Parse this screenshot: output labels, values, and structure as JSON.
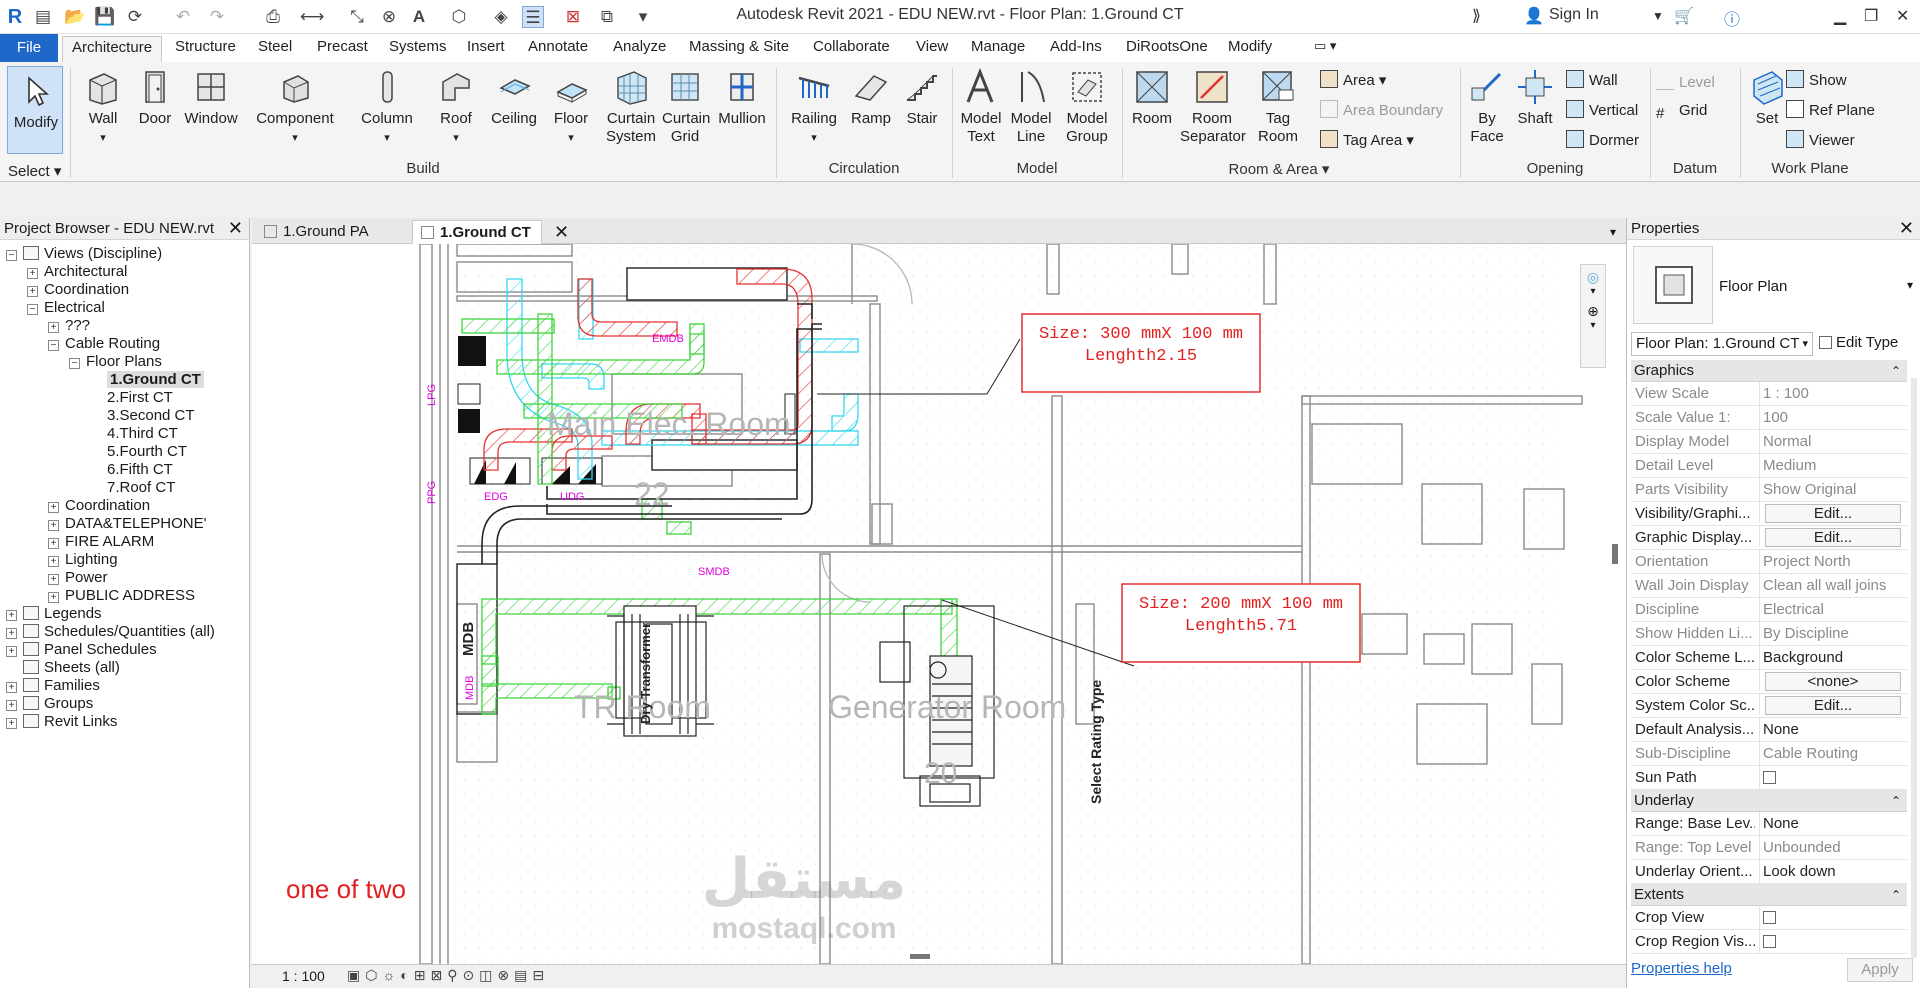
{
  "app": {
    "title": "Autodesk Revit 2021 - EDU NEW.rvt - Floor Plan: 1.Ground CT",
    "sign_in": "Sign In"
  },
  "ribbon_tabs": [
    "File",
    "Architecture",
    "Structure",
    "Steel",
    "Precast",
    "Systems",
    "Insert",
    "Annotate",
    "Analyze",
    "Massing & Site",
    "Collaborate",
    "View",
    "Manage",
    "Add-Ins",
    "DiRootsOne",
    "Modify"
  ],
  "ribbon": {
    "select_label": "Select",
    "modify": "Modify",
    "build": {
      "label": "Build",
      "wall": "Wall",
      "door": "Door",
      "window": "Window",
      "component": "Component",
      "column": "Column",
      "roof": "Roof",
      "ceiling": "Ceiling",
      "floor": "Floor",
      "curtain_system": [
        "Curtain",
        "System"
      ],
      "curtain_grid": [
        "Curtain",
        "Grid"
      ],
      "mullion": "Mullion"
    },
    "circulation": {
      "label": "Circulation",
      "railing": "Railing",
      "ramp": "Ramp",
      "stair": "Stair"
    },
    "model": {
      "label": "Model",
      "model_text": [
        "Model",
        "Text"
      ],
      "model_line": [
        "Model",
        "Line"
      ],
      "model_group": [
        "Model",
        "Group"
      ]
    },
    "room_area": {
      "label": "Room & Area",
      "room": "Room",
      "room_separator": [
        "Room",
        "Separator"
      ],
      "tag_room": [
        "Tag",
        "Room"
      ],
      "area": "Area",
      "area_boundary": "Area  Boundary",
      "tag_area": "Tag  Area"
    },
    "opening": {
      "label": "Opening",
      "by_face": [
        "By",
        "Face"
      ],
      "shaft": "Shaft",
      "wall": "Wall",
      "vertical": "Vertical",
      "dormer": "Dormer"
    },
    "datum": {
      "label": "Datum",
      "level": "Level",
      "grid": "Grid"
    },
    "work_plane": {
      "label": "Work Plane",
      "set": "Set",
      "show": "Show",
      "ref_plane": "Ref  Plane",
      "viewer": "Viewer"
    }
  },
  "project_browser": {
    "title": "Project Browser - EDU NEW.rvt",
    "items": [
      {
        "label": "Views (Discipline)",
        "indent": 0,
        "pm": "−",
        "icon": true
      },
      {
        "label": "Architectural",
        "indent": 1,
        "pm": "+"
      },
      {
        "label": "Coordination",
        "indent": 1,
        "pm": "+"
      },
      {
        "label": "Electrical",
        "indent": 1,
        "pm": "−"
      },
      {
        "label": "???",
        "indent": 2,
        "pm": "+"
      },
      {
        "label": "Cable Routing",
        "indent": 2,
        "pm": "−"
      },
      {
        "label": "Floor Plans",
        "indent": 3,
        "pm": "−"
      },
      {
        "label": "1.Ground CT",
        "indent": 4,
        "pm": "",
        "selected": true
      },
      {
        "label": "2.First CT",
        "indent": 4,
        "pm": ""
      },
      {
        "label": "3.Second CT",
        "indent": 4,
        "pm": ""
      },
      {
        "label": "4.Third CT",
        "indent": 4,
        "pm": ""
      },
      {
        "label": "5.Fourth CT",
        "indent": 4,
        "pm": ""
      },
      {
        "label": "6.Fifth CT",
        "indent": 4,
        "pm": ""
      },
      {
        "label": "7.Roof CT",
        "indent": 4,
        "pm": ""
      },
      {
        "label": "Coordination",
        "indent": 2,
        "pm": "+"
      },
      {
        "label": "DATA&TELEPHONE'",
        "indent": 2,
        "pm": "+"
      },
      {
        "label": "FIRE ALARM",
        "indent": 2,
        "pm": "+"
      },
      {
        "label": "Lighting",
        "indent": 2,
        "pm": "+"
      },
      {
        "label": "Power",
        "indent": 2,
        "pm": "+"
      },
      {
        "label": "PUBLIC ADDRESS",
        "indent": 2,
        "pm": "+"
      },
      {
        "label": "Legends",
        "indent": 0,
        "pm": "+",
        "icon": true
      },
      {
        "label": "Schedules/Quantities (all)",
        "indent": 0,
        "pm": "+",
        "icon": true
      },
      {
        "label": "Panel Schedules",
        "indent": 0,
        "pm": "+",
        "icon": true
      },
      {
        "label": "Sheets (all)",
        "indent": 0,
        "pm": "",
        "icon": true
      },
      {
        "label": "Families",
        "indent": 0,
        "pm": "+",
        "icon": true
      },
      {
        "label": "Groups",
        "indent": 0,
        "pm": "+",
        "icon": true
      },
      {
        "label": "Revit Links",
        "indent": 0,
        "pm": "+",
        "icon": true
      }
    ]
  },
  "view_tabs": [
    {
      "label": "1.Ground PA",
      "active": false
    },
    {
      "label": "1.Ground CT",
      "active": true
    }
  ],
  "drawing": {
    "rooms": [
      "Main Elec. Room",
      "22",
      "TR Room",
      "Generator Room",
      "20"
    ],
    "tags": [
      "EMDB",
      "SMDB",
      "LPG",
      "PPG",
      "EDG",
      "UDG",
      "MDB",
      "MDB"
    ],
    "callout1": [
      "Size:  300  mmX  100  mm",
      "Lenghth2.15"
    ],
    "callout2": [
      "Size:  200  mmX  100  mm",
      "Lenghth5.71"
    ],
    "transformer": "Dry Transformer",
    "select_rating": "Select Rating Type",
    "note": "one of two",
    "watermark_lettering": "مستقل",
    "watermark": "mostaql.com"
  },
  "status": {
    "scale": "1 : 100"
  },
  "properties": {
    "title": "Properties",
    "type": "Floor Plan",
    "selector": "Floor Plan: 1.Ground CT",
    "edit_type": "Edit Type",
    "sections": [
      {
        "name": "Graphics",
        "rows": [
          {
            "k": "View Scale",
            "v": "1 : 100",
            "dis": true
          },
          {
            "k": "Scale Value    1:",
            "v": "100",
            "dis": true
          },
          {
            "k": "Display Model",
            "v": "Normal",
            "dis": true
          },
          {
            "k": "Detail Level",
            "v": "Medium",
            "dis": true
          },
          {
            "k": "Parts Visibility",
            "v": "Show Original",
            "dis": true
          },
          {
            "k": "Visibility/Graphi...",
            "v": "Edit...",
            "btn": true
          },
          {
            "k": "Graphic Display...",
            "v": "Edit...",
            "btn": true
          },
          {
            "k": "Orientation",
            "v": "Project North",
            "dis": true
          },
          {
            "k": "Wall Join Display",
            "v": "Clean all wall joins",
            "dis": true
          },
          {
            "k": "Discipline",
            "v": "Electrical",
            "dis": true
          },
          {
            "k": "Show Hidden Li...",
            "v": "By Discipline",
            "dis": true
          },
          {
            "k": "Color Scheme L...",
            "v": "Background"
          },
          {
            "k": "Color Scheme",
            "v": "<none>",
            "btn": true
          },
          {
            "k": "System Color Sc...",
            "v": "Edit...",
            "btn": true
          },
          {
            "k": "Default Analysis...",
            "v": "None"
          },
          {
            "k": "Sub-Discipline",
            "v": "Cable Routing",
            "dis": true
          },
          {
            "k": "Sun Path",
            "v": "",
            "chk": true
          }
        ]
      },
      {
        "name": "Underlay",
        "rows": [
          {
            "k": "Range: Base Lev...",
            "v": "None"
          },
          {
            "k": "Range: Top Level",
            "v": "Unbounded",
            "dis": true
          },
          {
            "k": "Underlay Orient...",
            "v": "Look down"
          }
        ]
      },
      {
        "name": "Extents",
        "rows": [
          {
            "k": "Crop View",
            "v": "",
            "chk": true
          },
          {
            "k": "Crop Region Vis...",
            "v": "",
            "chk": true
          }
        ]
      }
    ],
    "help": "Properties help",
    "apply": "Apply"
  },
  "colors": {
    "accent": "#1f68c9",
    "tray_green": "#3dd43d",
    "tray_red": "#e53030",
    "tray_cyan": "#35d8f0",
    "magenta": "#e000e0",
    "callout_red": "#e32020"
  }
}
